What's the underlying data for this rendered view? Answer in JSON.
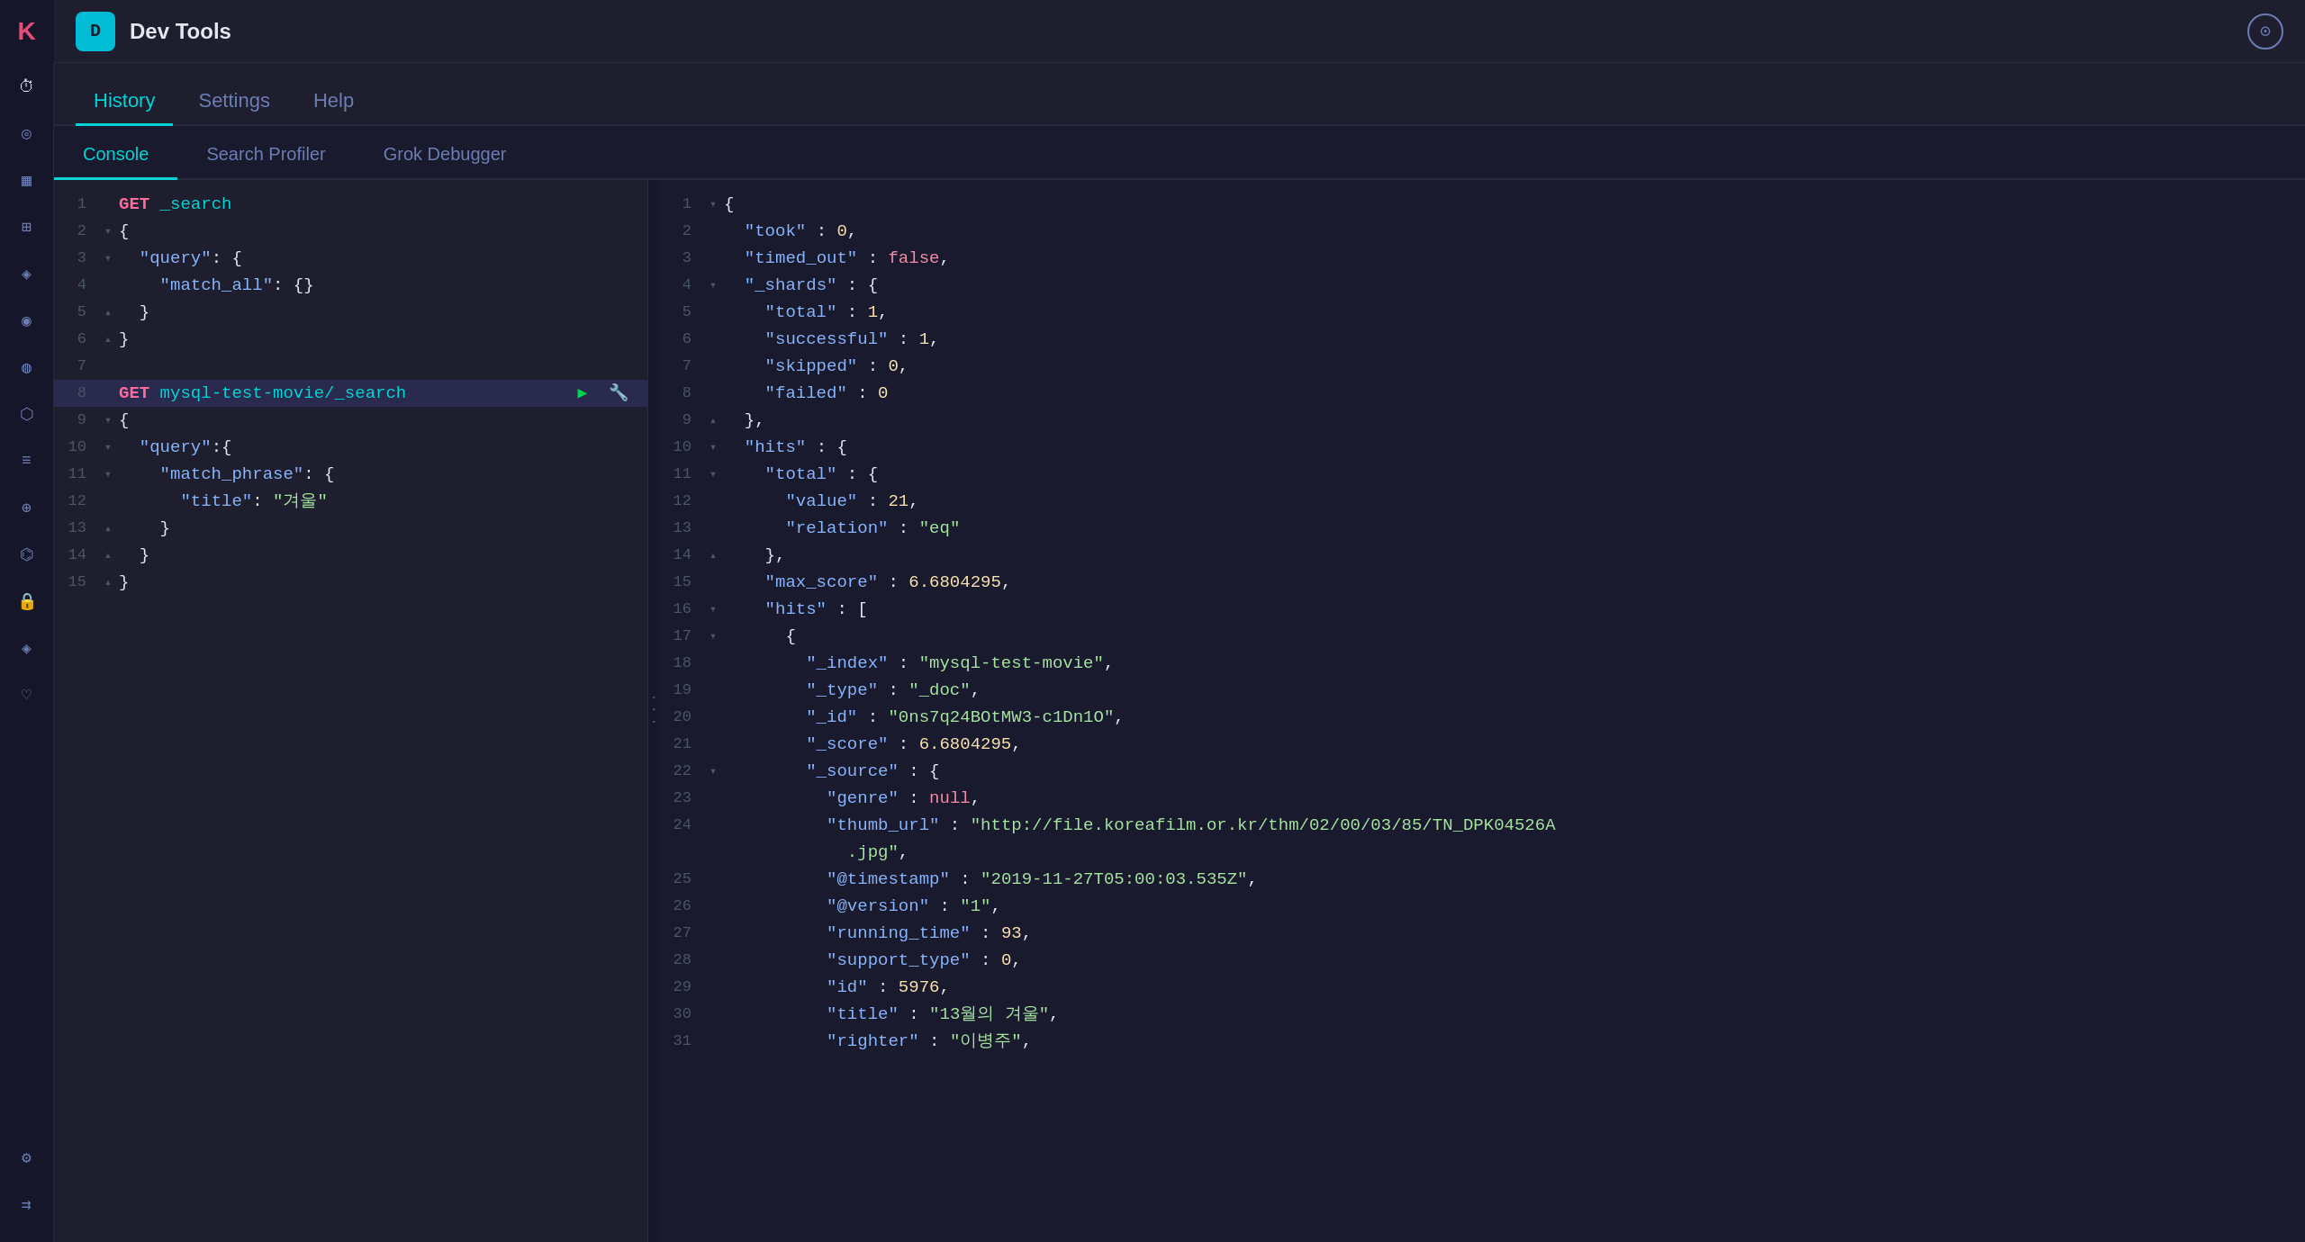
{
  "app": {
    "icon_letter": "D",
    "title": "Dev Tools",
    "icon_bg": "#00bcd4"
  },
  "nav": {
    "items": [
      "History",
      "Settings",
      "Help"
    ],
    "active": "History"
  },
  "tabs": [
    {
      "label": "Console",
      "active": true
    },
    {
      "label": "Search Profiler",
      "active": false
    },
    {
      "label": "Grok Debugger",
      "active": false
    }
  ],
  "sidebar_icons": [
    {
      "name": "clock-icon",
      "symbol": "🕐"
    },
    {
      "name": "compass-icon",
      "symbol": "◎"
    },
    {
      "name": "chart-bar-icon",
      "symbol": "▦"
    },
    {
      "name": "table-icon",
      "symbol": "⊞"
    },
    {
      "name": "dashboard-icon",
      "symbol": "◈"
    },
    {
      "name": "map-icon",
      "symbol": "◉"
    },
    {
      "name": "graph-icon",
      "symbol": "◍"
    },
    {
      "name": "package-icon",
      "symbol": "⬡"
    },
    {
      "name": "list-icon",
      "symbol": "≡"
    },
    {
      "name": "layers-icon",
      "symbol": "⊕"
    },
    {
      "name": "flask-icon",
      "symbol": "⌬"
    },
    {
      "name": "lock-icon",
      "symbol": "🔒"
    },
    {
      "name": "bug-icon",
      "symbol": "◈"
    },
    {
      "name": "heart-icon",
      "symbol": "♡"
    },
    {
      "name": "settings-icon",
      "symbol": "⚙"
    },
    {
      "name": "menu-icon",
      "symbol": "⇉"
    }
  ],
  "editor": {
    "lines": [
      {
        "num": 1,
        "fold": " ",
        "content": "GET _search",
        "type": "code",
        "parts": [
          {
            "text": "GET",
            "cls": "kw-get"
          },
          {
            "text": " _search",
            "cls": "kw-path"
          }
        ]
      },
      {
        "num": 2,
        "fold": "▾",
        "content": "{",
        "type": "code"
      },
      {
        "num": 3,
        "fold": "▾",
        "content": "  \"query\": {",
        "type": "code"
      },
      {
        "num": 4,
        "fold": " ",
        "content": "    \"match_all\": {}",
        "type": "code"
      },
      {
        "num": 5,
        "fold": "▴",
        "content": "  }",
        "type": "code"
      },
      {
        "num": 6,
        "fold": "▴",
        "content": "}",
        "type": "code"
      },
      {
        "num": 7,
        "fold": " ",
        "content": "",
        "type": "code"
      },
      {
        "num": 8,
        "fold": " ",
        "content": "GET mysql-test-movie/_search",
        "type": "code",
        "highlighted": true,
        "has_actions": true
      },
      {
        "num": 9,
        "fold": "▾",
        "content": "{",
        "type": "code",
        "highlighted": false
      },
      {
        "num": 10,
        "fold": "▾",
        "content": "  \"query\":{",
        "type": "code"
      },
      {
        "num": 11,
        "fold": "▾",
        "content": "    \"match_phrase\": {",
        "type": "code"
      },
      {
        "num": 12,
        "fold": " ",
        "content": "      \"title\": \"겨울\"",
        "type": "code"
      },
      {
        "num": 13,
        "fold": "▴",
        "content": "    }",
        "type": "code"
      },
      {
        "num": 14,
        "fold": "▴",
        "content": "  }",
        "type": "code"
      },
      {
        "num": 15,
        "fold": "▴",
        "content": "}",
        "type": "code"
      }
    ]
  },
  "output": {
    "lines": [
      {
        "num": 1,
        "fold": "▾",
        "raw": "{"
      },
      {
        "num": 2,
        "fold": " ",
        "raw": "  \"took\" : 0,"
      },
      {
        "num": 3,
        "fold": " ",
        "raw": "  \"timed_out\" : false,"
      },
      {
        "num": 4,
        "fold": "▾",
        "raw": "  \"_shards\" : {"
      },
      {
        "num": 5,
        "fold": " ",
        "raw": "    \"total\" : 1,"
      },
      {
        "num": 6,
        "fold": " ",
        "raw": "    \"successful\" : 1,"
      },
      {
        "num": 7,
        "fold": " ",
        "raw": "    \"skipped\" : 0,"
      },
      {
        "num": 8,
        "fold": " ",
        "raw": "    \"failed\" : 0"
      },
      {
        "num": 9,
        "fold": "▴",
        "raw": "  },"
      },
      {
        "num": 10,
        "fold": "▾",
        "raw": "  \"hits\" : {"
      },
      {
        "num": 11,
        "fold": "▾",
        "raw": "    \"total\" : {"
      },
      {
        "num": 12,
        "fold": " ",
        "raw": "      \"value\" : 21,"
      },
      {
        "num": 13,
        "fold": " ",
        "raw": "      \"relation\" : \"eq\""
      },
      {
        "num": 14,
        "fold": "▴",
        "raw": "    },"
      },
      {
        "num": 15,
        "fold": " ",
        "raw": "    \"max_score\" : 6.6804295,"
      },
      {
        "num": 16,
        "fold": "▾",
        "raw": "    \"hits\" : ["
      },
      {
        "num": 17,
        "fold": "▾",
        "raw": "      {"
      },
      {
        "num": 18,
        "fold": " ",
        "raw": "        \"_index\" : \"mysql-test-movie\","
      },
      {
        "num": 19,
        "fold": " ",
        "raw": "        \"_type\" : \"_doc\","
      },
      {
        "num": 20,
        "fold": " ",
        "raw": "        \"_id\" : \"0ns7q24BOtMW3-c1Dn1O\","
      },
      {
        "num": 21,
        "fold": " ",
        "raw": "        \"_score\" : 6.6804295,"
      },
      {
        "num": 22,
        "fold": "▾",
        "raw": "        \"_source\" : {"
      },
      {
        "num": 23,
        "fold": " ",
        "raw": "          \"genre\" : null,"
      },
      {
        "num": 24,
        "fold": " ",
        "raw": "          \"thumb_url\" : \"http://file.koreafilm.or.kr/thm/02/00/03/85/TN_DPK04526A.jpg\","
      },
      {
        "num": 25,
        "fold": " ",
        "raw": "          \"@timestamp\" : \"2019-11-27T05:00:03.535Z\","
      },
      {
        "num": 26,
        "fold": " ",
        "raw": "          \"@version\" : \"1\","
      },
      {
        "num": 27,
        "fold": " ",
        "raw": "          \"running_time\" : 93,"
      },
      {
        "num": 28,
        "fold": " ",
        "raw": "          \"support_type\" : 0,"
      },
      {
        "num": 29,
        "fold": " ",
        "raw": "          \"id\" : 5976,"
      },
      {
        "num": 30,
        "fold": " ",
        "raw": "          \"title\" : \"13월의 겨울\","
      },
      {
        "num": 31,
        "fold": " ",
        "raw": "          \"righter\" : \"이병주\","
      }
    ]
  }
}
